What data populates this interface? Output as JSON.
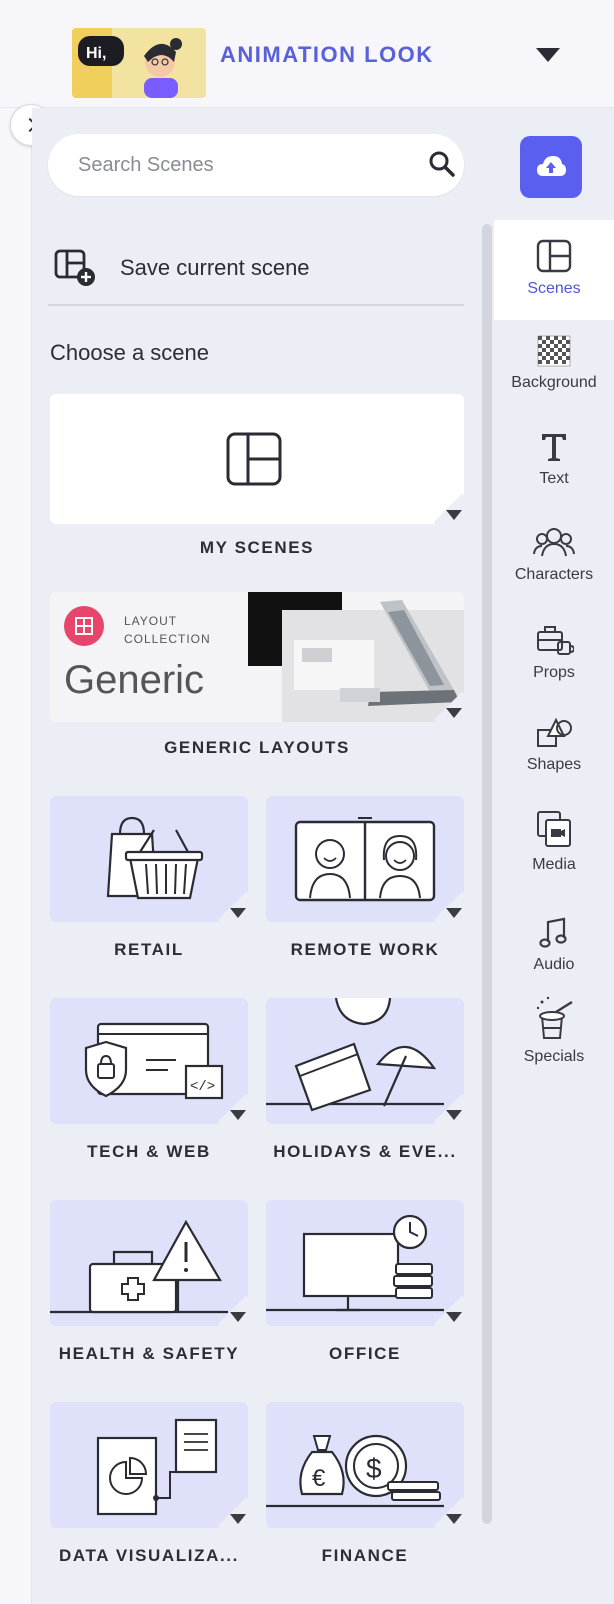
{
  "header": {
    "title": "ANIMATION LOOK",
    "thumb_text": "Hi,"
  },
  "search": {
    "placeholder": "Search Scenes"
  },
  "panel": {
    "save_label": "Save current scene",
    "choose_label": "Choose a scene"
  },
  "cards": {
    "my_scenes": "MY SCENES",
    "generic": {
      "label": "GENERIC LAYOUTS",
      "badge_line1": "LAYOUT",
      "badge_line2": "COLLECTION",
      "big_text": "Generic"
    },
    "retail": "RETAIL",
    "remote_work": "REMOTE WORK",
    "tech_web": "TECH & WEB",
    "holidays": "HOLIDAYS & EVE...",
    "health": "HEALTH & SAFETY",
    "office": "OFFICE",
    "data_viz": "DATA VISUALIZA...",
    "finance": "FINANCE"
  },
  "rail": {
    "scenes": "Scenes",
    "background": "Background",
    "text": "Text",
    "characters": "Characters",
    "props": "Props",
    "shapes": "Shapes",
    "media": "Media",
    "audio": "Audio",
    "specials": "Specials"
  },
  "colors": {
    "accent": "#5960d8",
    "upload_bg": "#5b5ff0",
    "card_bg": "#dfe1fa",
    "panel_bg": "#eceef5"
  }
}
